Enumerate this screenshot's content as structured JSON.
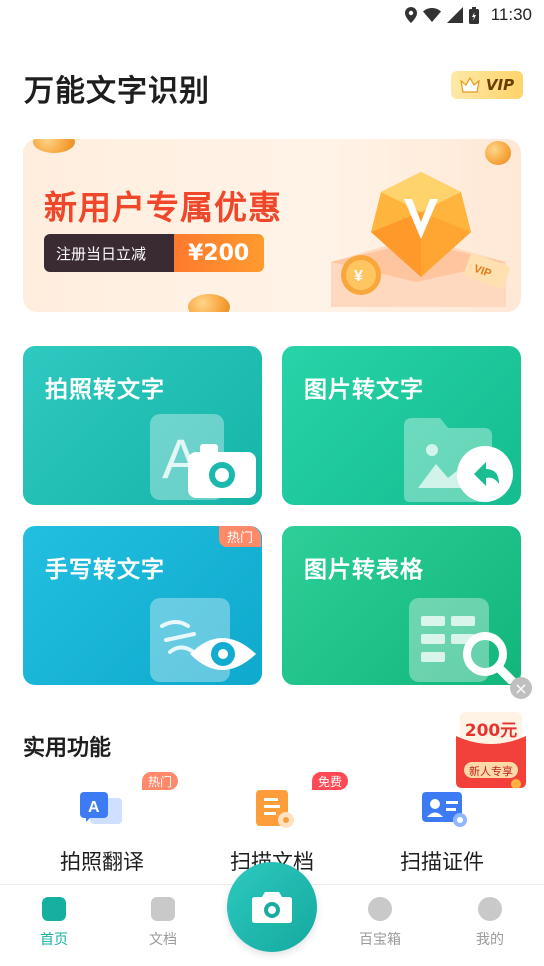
{
  "status_bar": {
    "time": "11:30"
  },
  "header": {
    "title": "万能文字识别",
    "vip_label": "VIP"
  },
  "banner": {
    "headline": "新用户专属优惠",
    "promo_left": "注册当日立减",
    "promo_right": "¥200"
  },
  "cards": [
    {
      "label": "拍照转文字"
    },
    {
      "label": "图片转文字"
    },
    {
      "label": "手写转文字",
      "tag": "热门"
    },
    {
      "label": "图片转表格"
    }
  ],
  "floating_promo": {
    "amount": "200元",
    "label": "新人专享"
  },
  "utilities": {
    "title": "实用功能",
    "items": [
      {
        "label": "拍照翻译",
        "tag": "热门",
        "tag_color": "#ff8a6a"
      },
      {
        "label": "扫描文档",
        "tag": "免费",
        "tag_color": "#ff4a55"
      },
      {
        "label": "扫描证件"
      }
    ]
  },
  "tabbar": {
    "items": [
      {
        "label": "首页",
        "active": true
      },
      {
        "label": "文档"
      },
      {
        "label": "百宝箱"
      },
      {
        "label": "我的"
      }
    ]
  }
}
